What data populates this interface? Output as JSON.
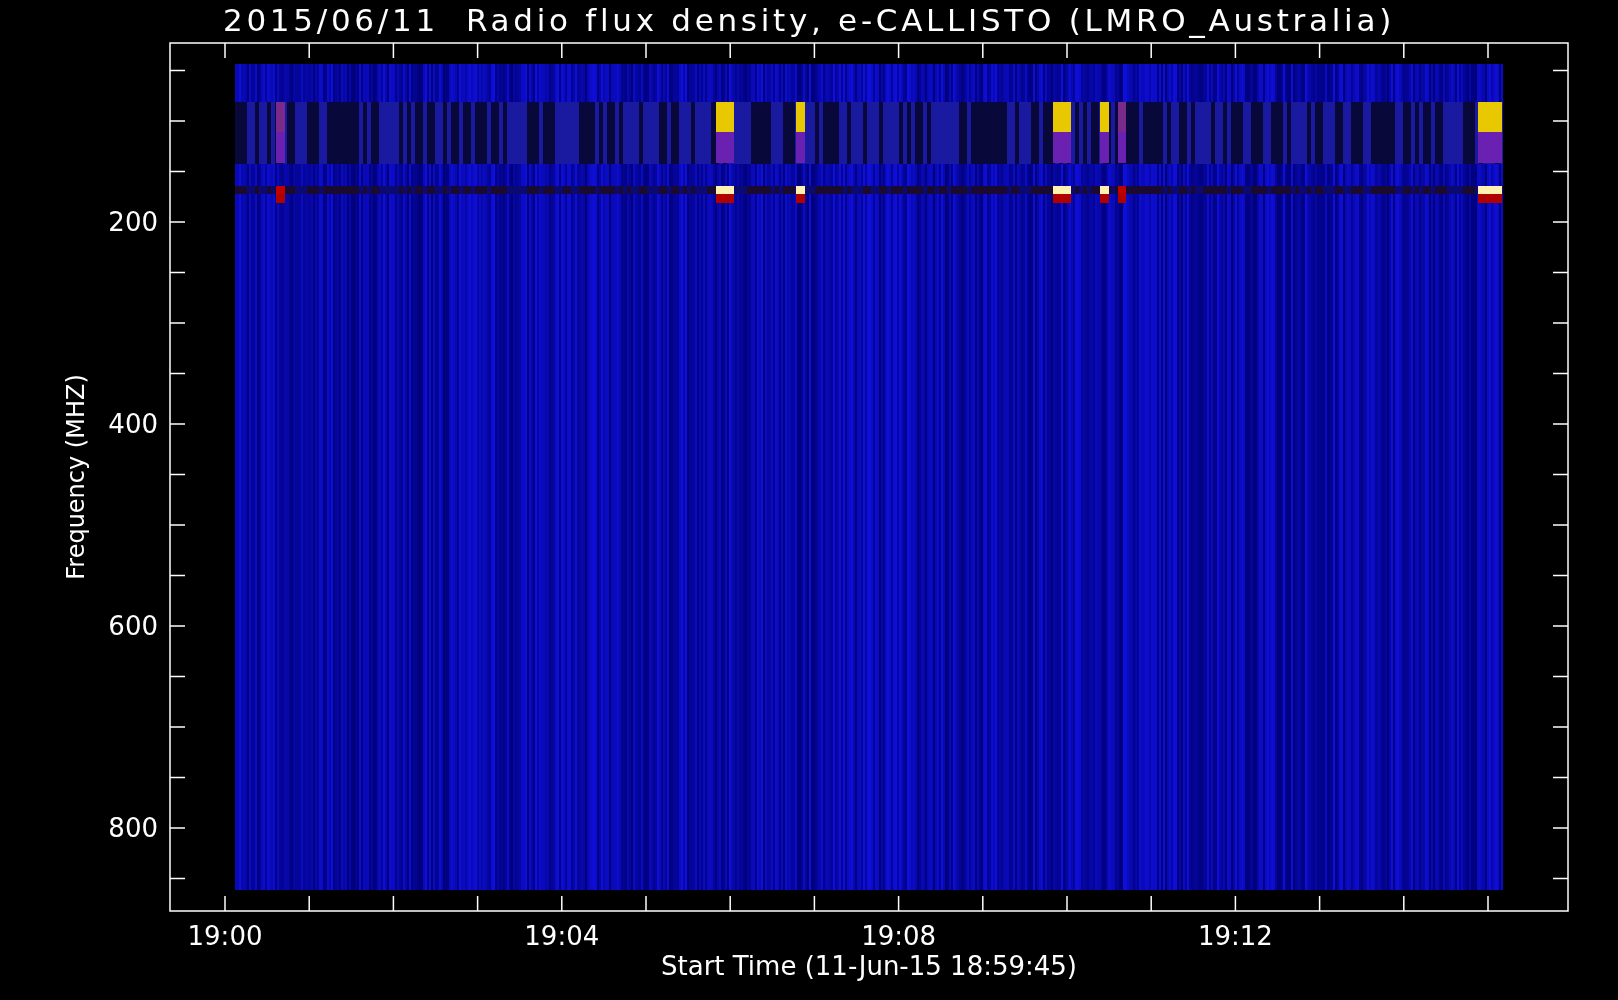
{
  "title": "2015/06/11  Radio flux density, e-CALLISTO (LMRO_Australia)",
  "ylabel": "Frequency (MHZ)",
  "xlabel": "Start Time (11-Jun-15 18:59:45)",
  "yticks": [
    "200",
    "400",
    "600",
    "800"
  ],
  "xticks": [
    "19:00",
    "19:04",
    "19:08",
    "19:12"
  ]
}
